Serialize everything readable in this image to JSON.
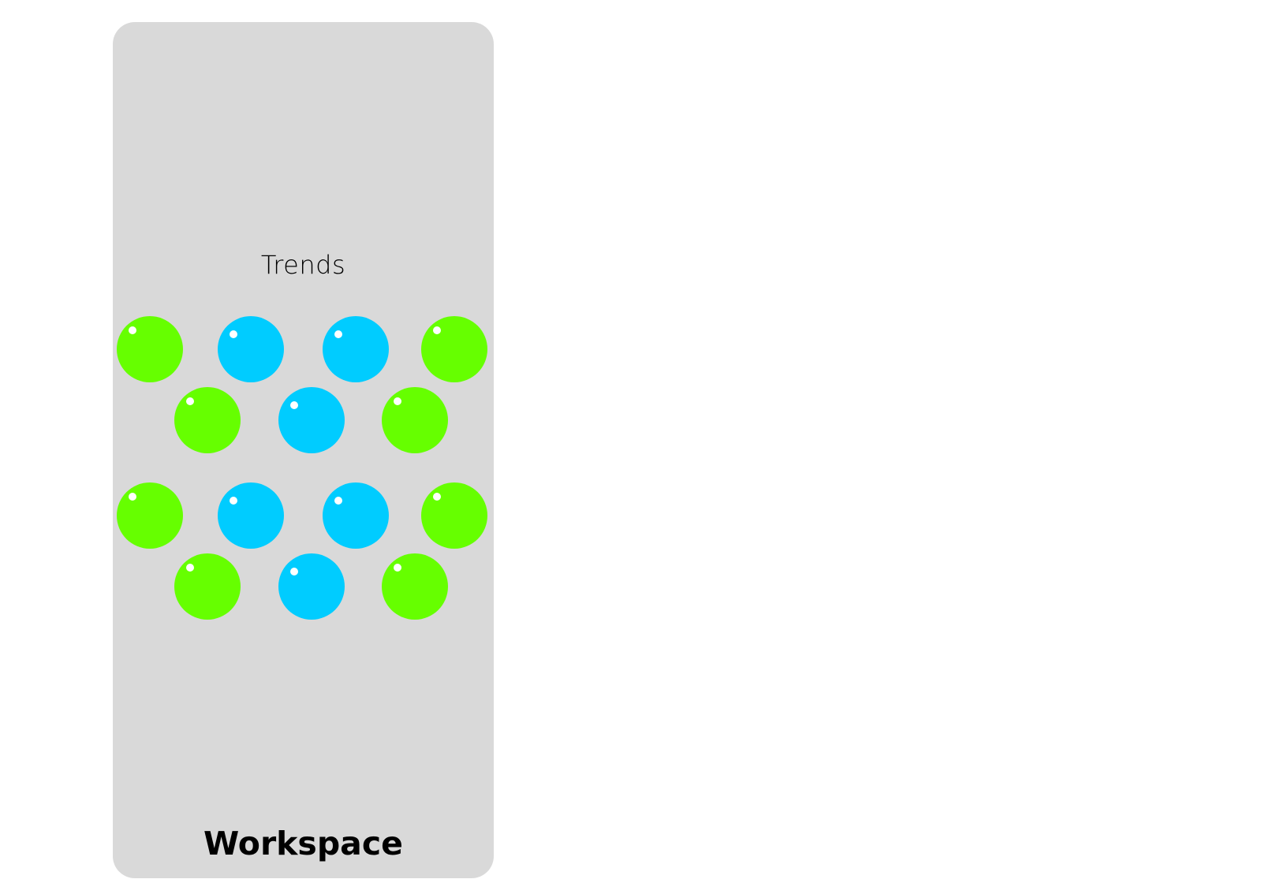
{
  "panel": {
    "title": "Trends",
    "footer": "Workspace"
  },
  "colors": {
    "panel_background": "#d9d9d9",
    "green_bubble": "#66ff00",
    "blue_bubble": "#00ccff",
    "highlight": "#ffffff"
  },
  "bubbles": [
    {
      "color": "green"
    },
    {
      "color": "blue"
    },
    {
      "color": "blue"
    },
    {
      "color": "green"
    },
    {
      "color": "green"
    },
    {
      "color": "blue"
    },
    {
      "color": "green"
    },
    {
      "color": "green"
    },
    {
      "color": "blue"
    },
    {
      "color": "blue"
    },
    {
      "color": "green"
    },
    {
      "color": "green"
    },
    {
      "color": "blue"
    },
    {
      "color": "green"
    }
  ]
}
